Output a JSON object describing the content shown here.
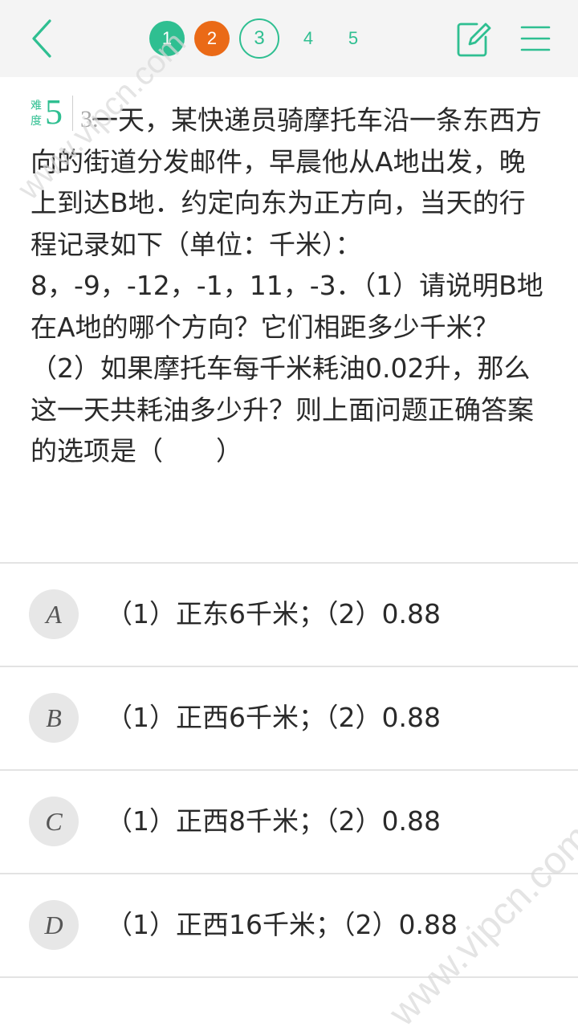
{
  "topbar": {
    "pages": [
      {
        "label": "1",
        "state": "done"
      },
      {
        "label": "2",
        "state": "wrong"
      },
      {
        "label": "3",
        "state": "current"
      },
      {
        "label": "4",
        "state": "plain"
      },
      {
        "label": "5",
        "state": "plain"
      }
    ],
    "icons": [
      "chevron-left-icon",
      "edit-icon",
      "menu-icon"
    ],
    "colors": {
      "accent": "#2fbf91",
      "wrong": "#ea6a17"
    }
  },
  "question": {
    "difficulty_label": "难度",
    "difficulty_value": "5",
    "number": "3.",
    "text": "一天，某快递员骑摩托车沿一条东西方向的街道分发邮件，早晨他从A地出发，晚上到达B地．约定向东为正方向，当天的行程记录如下（单位：千米）：8，-9，-12，-1，11，-3．（1）请说明B地在A地的哪个方向？它们相距多少千米？（2）如果摩托车每千米耗油0.02升，那么这一天共耗油多少升？则上面问题正确答案的选项是（　　）"
  },
  "options": [
    {
      "letter": "A",
      "text": "（1）正东6千米；（2）0.88"
    },
    {
      "letter": "B",
      "text": "（1）正西6千米；（2）0.88"
    },
    {
      "letter": "C",
      "text": "（1）正西8千米；（2）0.88"
    },
    {
      "letter": "D",
      "text": "（1）正西16千米；（2）0.88"
    }
  ],
  "watermark": "www.vipcn.com"
}
